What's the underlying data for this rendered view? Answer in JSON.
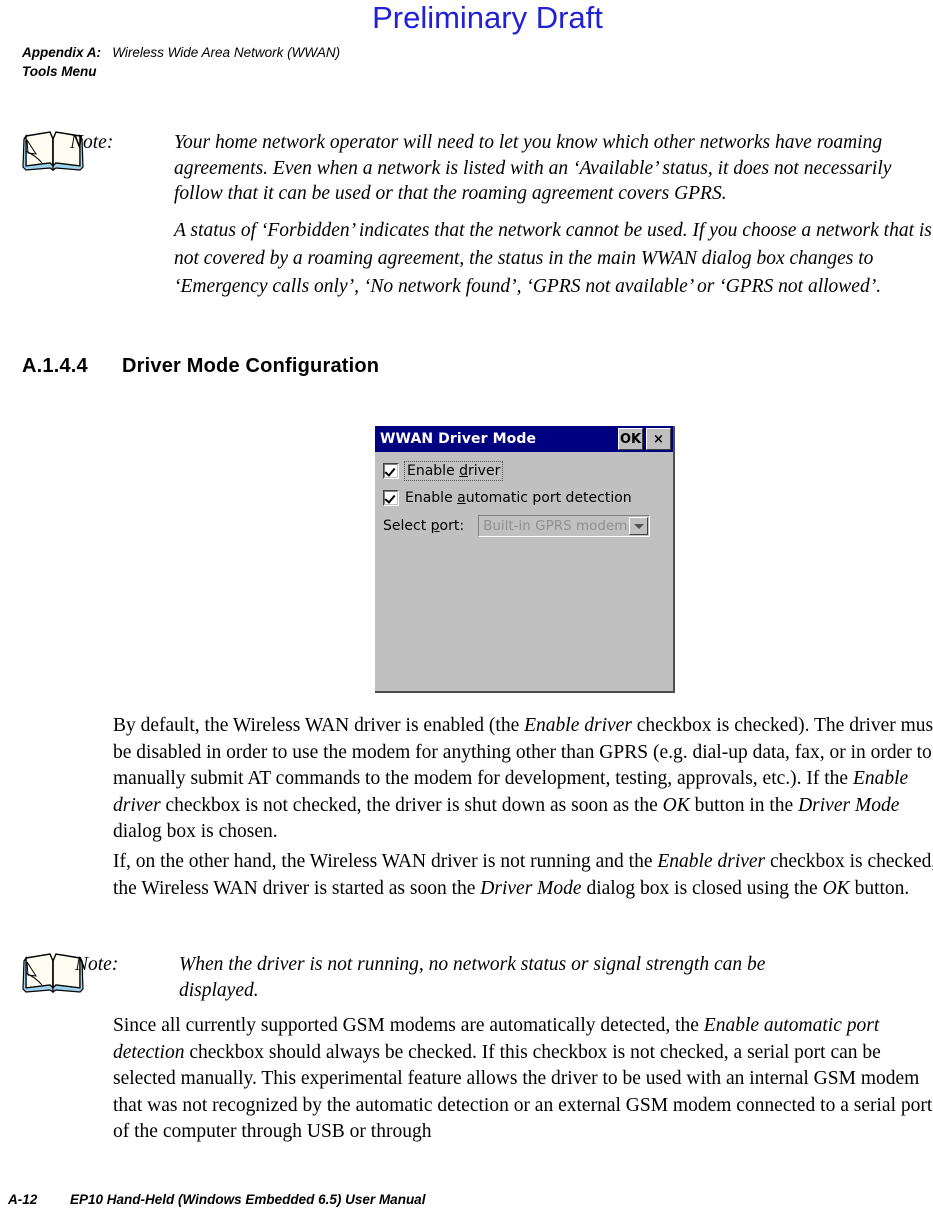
{
  "watermark": "Preliminary Draft",
  "running_head": {
    "appendix_label": "Appendix A:",
    "appendix_title": "Wireless Wide Area Network (WWAN)",
    "subtitle": "Tools Menu"
  },
  "note_top": {
    "icon": "open-book-icon",
    "label": "Note:",
    "paragraph1": "Your home network operator will need to let you know which other networks have roaming agreements. Even when a network is listed with an ‘Available’ status, it does not necessarily follow that it can be used or that the roaming agreement covers GPRS.",
    "paragraph2": "A status of ‘Forbidden’ indicates that the network cannot be used. If you choose a network that is not covered by a roaming agreement, the status in the main WWAN dialog box changes to ‘Emergency calls only’, ‘No network found’, ‘GPRS not available’ or ‘GPRS not allowed’."
  },
  "section": {
    "number": "A.1.4.4",
    "title": "Driver Mode Configuration"
  },
  "dialog": {
    "title": "WWAN Driver Mode",
    "ok_label": "OK",
    "close_label": "×",
    "checkbox_enable_driver": {
      "label_pre": "Enable ",
      "label_mnemonic": "d",
      "label_post": "river",
      "checked": true
    },
    "checkbox_auto_port": {
      "label_pre": "Enable ",
      "label_mnemonic": "a",
      "label_post": "utomatic port detection",
      "checked": true
    },
    "select_port": {
      "label_pre": "Select ",
      "label_mnemonic": "p",
      "label_post": "ort:",
      "value": "Built-in GPRS modem",
      "disabled": true
    },
    "colors": {
      "titlebar": "#000080",
      "face": "#c0c0c0",
      "disabled_text": "#909090"
    }
  },
  "body": {
    "para1_a": "By default, the Wireless WAN driver is enabled (the ",
    "para1_i1": "Enable driver",
    "para1_b": " checkbox is checked). The driver must be disabled in order to use the modem for anything other than GPRS (e.g. dial-up data, fax, or in order to manually submit AT commands to the modem for development, testing, approvals, etc.). If the ",
    "para1_i2": "Enable driver",
    "para1_c": " checkbox is not checked, the driver is shut down as soon as the ",
    "para1_i3": "OK",
    "para1_d": " button in the ",
    "para1_i4": "Driver Mode",
    "para1_e": " dialog box is chosen.",
    "para2_a": "If, on the other hand, the Wireless WAN driver is not running and the ",
    "para2_i1": "Enable driver",
    "para2_b": " checkbox is checked, the Wireless WAN driver is started as soon the ",
    "para2_i2": "Driver Mode",
    "para2_c": " dialog box is closed using the ",
    "para2_i3": "OK",
    "para2_d": " button.",
    "para3_a": "Since all currently supported GSM modems are automatically detected, the ",
    "para3_i1": "Enable automatic port detection",
    "para3_b": " checkbox should always be checked. If this checkbox is not checked, a serial port can be selected manually. This experimental feature allows the driver to be used with an internal GSM modem that was not recognized by the automatic detection or an external GSM modem connected to a serial port of the computer through USB or through"
  },
  "note_bottom": {
    "icon": "open-book-icon",
    "label": "Note:",
    "paragraph1": "When the driver is not running, no network status or signal strength can be displayed."
  },
  "footer": {
    "page_number": "A-12",
    "manual_title": "EP10 Hand-Held (Windows Embedded 6.5) User Manual"
  }
}
